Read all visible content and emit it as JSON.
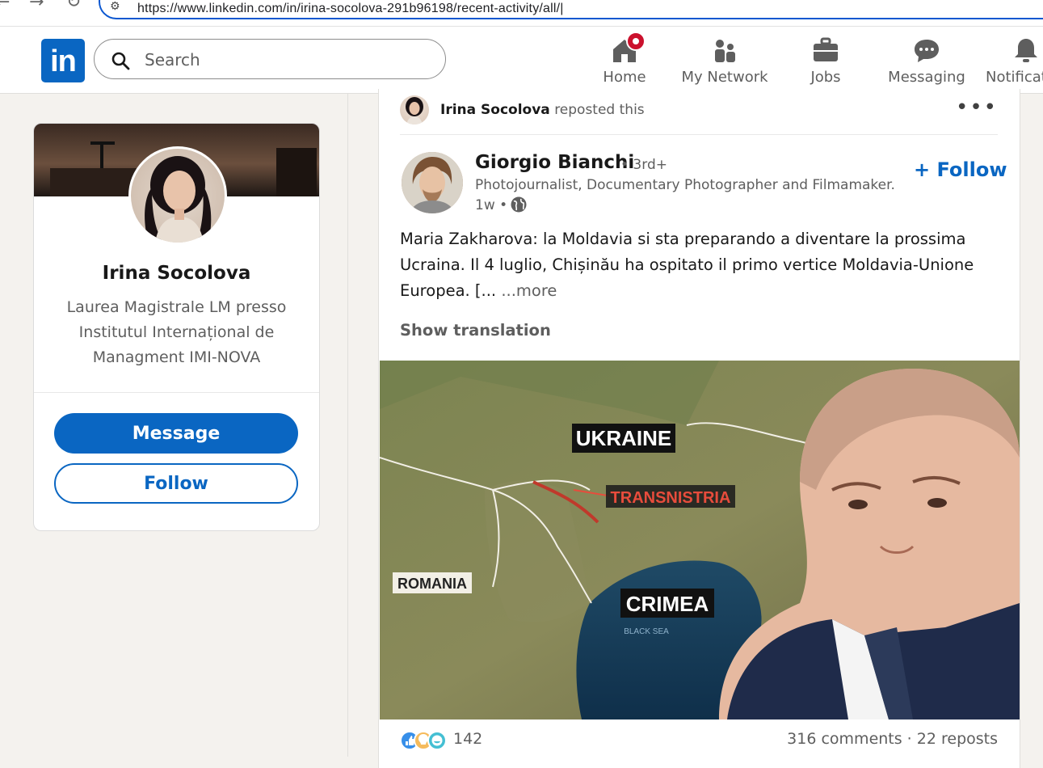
{
  "browser": {
    "url": "https://www.linkedin.com/in/irina-socolova-291b96198/recent-activity/all/|"
  },
  "header": {
    "logo_text": "in",
    "search_placeholder": "Search",
    "nav": [
      {
        "label": "Home",
        "icon": "home-icon"
      },
      {
        "label": "My Network",
        "icon": "people-icon"
      },
      {
        "label": "Jobs",
        "icon": "briefcase-icon"
      },
      {
        "label": "Messaging",
        "icon": "messaging-icon"
      },
      {
        "label": "Notificat",
        "icon": "bell-icon"
      }
    ]
  },
  "profile": {
    "name": "Irina Socolova",
    "headline": "Laurea Magistrale LM presso Institutul Internațional de Managment IMI-NOVA",
    "message_label": "Message",
    "follow_label": "Follow"
  },
  "post": {
    "reposter_name": "Irina Socolova",
    "reposter_action": "reposted this",
    "author_name": "Giorgio Bianchi",
    "author_degree": "• 3rd+",
    "author_headline": "Photojournalist, Documentary Photographer and Filmamaker.",
    "time": "1w •",
    "follow_label": "+ Follow",
    "text": "Maria Zakharova: la Moldavia si sta preparando a diventare la prossima Ucraina. Il 4 luglio, Chișinău ha ospitato il primo vertice Moldavia-Unione Europea. [...",
    "more_label": " ...more",
    "translation_label": "Show translation",
    "image_labels": {
      "ukraine": "UKRAINE",
      "transnistria": "TRANSNISTRIA",
      "romania": "ROMANIA",
      "crimea": "CRIMEA",
      "black_sea": "BLACK SEA"
    },
    "reaction_count": "142",
    "comments_reposts": "316 comments · 22 reposts"
  },
  "colors": {
    "brand": "#0a66c2",
    "notification": "#cb112d",
    "page_bg": "#f4f2ee"
  }
}
